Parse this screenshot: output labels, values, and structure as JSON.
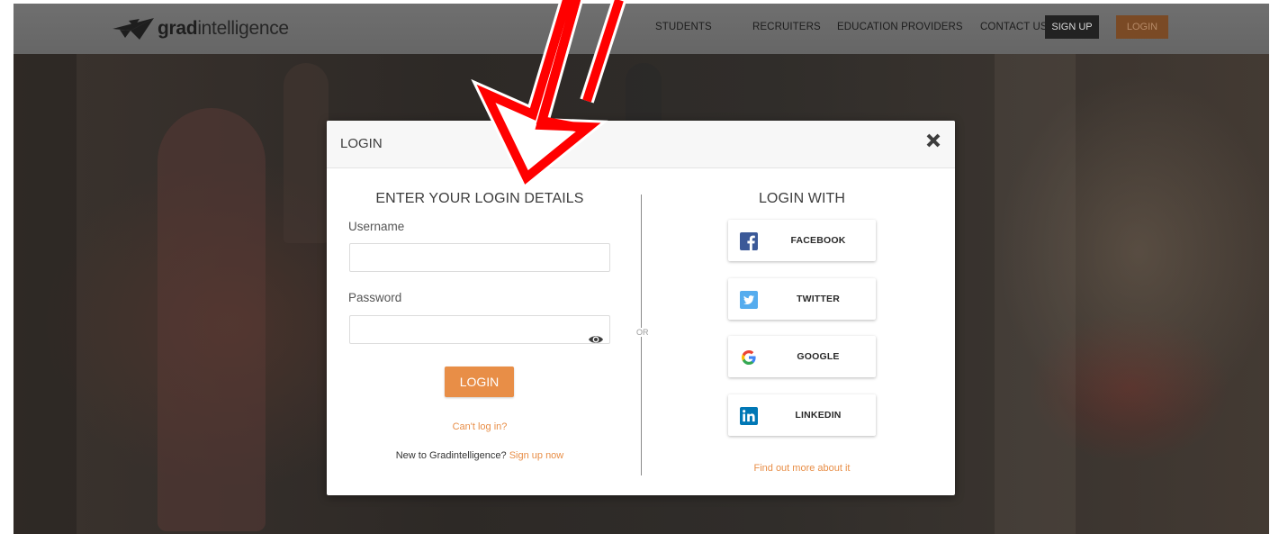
{
  "header": {
    "brand_bold": "grad",
    "brand_light": "intelligence",
    "nav": [
      "STUDENTS",
      "RECRUITERS",
      "EDUCATION PROVIDERS",
      "CONTACT US"
    ],
    "signup_label": "SIGN UP",
    "login_label": "LOGIN"
  },
  "modal": {
    "title": "LOGIN",
    "left": {
      "heading": "ENTER YOUR LOGIN DETAILS",
      "username_label": "Username",
      "username_value": "",
      "password_label": "Password",
      "password_value": "",
      "login_button": "LOGIN",
      "cant_login": "Can't log in?",
      "new_user_text": "New to Gradintelligence?",
      "signup_link": "Sign up now"
    },
    "or_text": "OR",
    "right": {
      "heading": "LOGIN WITH",
      "providers": [
        {
          "label": "FACEBOOK",
          "icon": "facebook-icon",
          "color": "#3b5998"
        },
        {
          "label": "TWITTER",
          "icon": "twitter-icon",
          "color": "#55acee"
        },
        {
          "label": "GOOGLE",
          "icon": "google-icon",
          "color": "#4285f4"
        },
        {
          "label": "LINKEDIN",
          "icon": "linkedin-icon",
          "color": "#0077b5"
        }
      ],
      "find_more": "Find out more about it"
    }
  },
  "colors": {
    "accent": "#e88e47",
    "annotation": "#ff0000"
  }
}
